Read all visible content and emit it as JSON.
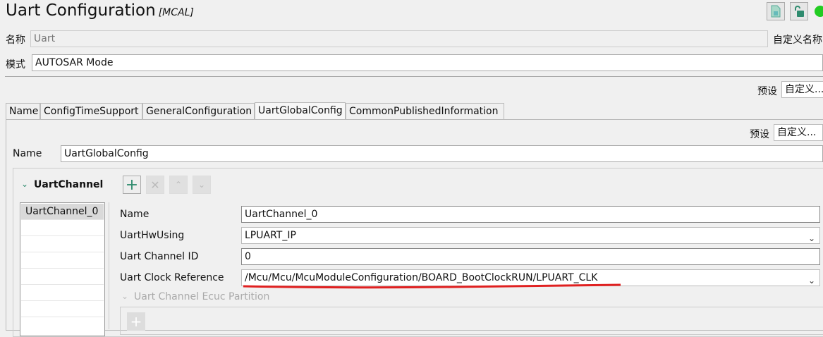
{
  "header": {
    "title": "Uart Configuration",
    "subtitle": "[MCAL]"
  },
  "name_row": {
    "label": "名称",
    "value": "Uart",
    "custom_label": "自定义名称"
  },
  "mode_row": {
    "label": "模式",
    "value": "AUTOSAR Mode"
  },
  "preset_top": {
    "label": "预设",
    "value": "自定义..."
  },
  "tabs": [
    {
      "label": "Name"
    },
    {
      "label": "ConfigTimeSupport"
    },
    {
      "label": "GeneralConfiguration"
    },
    {
      "label": "UartGlobalConfig"
    },
    {
      "label": "CommonPublishedInformation"
    }
  ],
  "panel": {
    "preset": {
      "label": "预设",
      "value": "自定义..."
    },
    "name": {
      "label": "Name",
      "value": "UartGlobalConfig"
    },
    "group": {
      "title": "UartChannel",
      "list": [
        "UartChannel_0"
      ],
      "fields": {
        "name": {
          "label": "Name",
          "value": "UartChannel_0"
        },
        "hw": {
          "label": "UartHwUsing",
          "value": "LPUART_IP"
        },
        "id": {
          "label": "Uart Channel ID",
          "value": "0"
        },
        "clock": {
          "label": "Uart Clock Reference",
          "value": "/Mcu/Mcu/McuModuleConfiguration/BOARD_BootClockRUN/LPUART_CLK"
        }
      },
      "ecuc_label": "Uart Channel Ecuc Partition"
    }
  },
  "colors": {
    "accent": "#2e8b6e",
    "annotation": "#e02020",
    "status": "#22cc22"
  }
}
